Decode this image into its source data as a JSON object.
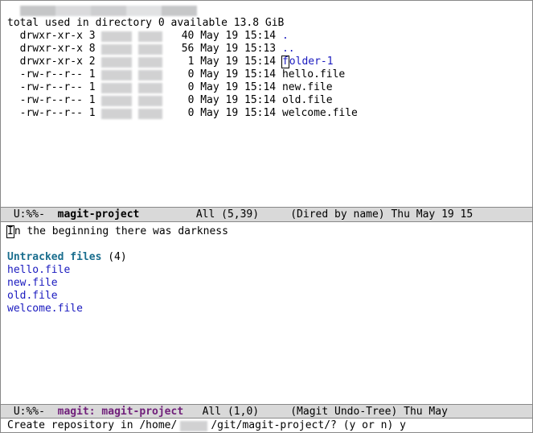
{
  "dired": {
    "summary": "total used in directory 0 available 13.8 GiB",
    "entries": [
      {
        "perm": "drwxr-xr-x",
        "links": "3",
        "size": "40",
        "date": "May 19 15:14",
        "name": ".",
        "kind": "dir"
      },
      {
        "perm": "drwxr-xr-x",
        "links": "8",
        "size": "56",
        "date": "May 19 15:13",
        "name": "..",
        "kind": "dir"
      },
      {
        "perm": "drwxr-xr-x",
        "links": "2",
        "size": "1",
        "date": "May 19 15:14",
        "name": "folder-1",
        "kind": "dir",
        "cursor": true
      },
      {
        "perm": "-rw-r--r--",
        "links": "1",
        "size": "0",
        "date": "May 19 15:14",
        "name": "hello.file",
        "kind": "file"
      },
      {
        "perm": "-rw-r--r--",
        "links": "1",
        "size": "0",
        "date": "May 19 15:14",
        "name": "new.file",
        "kind": "file"
      },
      {
        "perm": "-rw-r--r--",
        "links": "1",
        "size": "0",
        "date": "May 19 15:14",
        "name": "old.file",
        "kind": "file"
      },
      {
        "perm": "-rw-r--r--",
        "links": "1",
        "size": "0",
        "date": "May 19 15:14",
        "name": "welcome.file",
        "kind": "file"
      }
    ]
  },
  "modeline1": {
    "left": " U:%%-  ",
    "buffer": "magit-project",
    "pos": "   All (5,39)    ",
    "mode": "(Dired by name)",
    "time": " Thu May 19 15"
  },
  "magit": {
    "head_msg_prefix_cursor": "I",
    "head_msg_rest": "n the beginning there was darkness",
    "untracked_label": "Untracked files",
    "untracked_count": " (4)",
    "untracked": [
      "hello.file",
      "new.file",
      "old.file",
      "welcome.file"
    ]
  },
  "modeline2": {
    "left": " U:%%-  ",
    "buffer": "magit: magit-project",
    "pos": "   All (1,0)    ",
    "mode": "(Magit Undo-Tree)",
    "time": " Thu May"
  },
  "minibuffer": {
    "prompt_a": "Create repository in /home/",
    "prompt_b": "/git/magit-project/? (y or n) ",
    "answer": "y"
  }
}
